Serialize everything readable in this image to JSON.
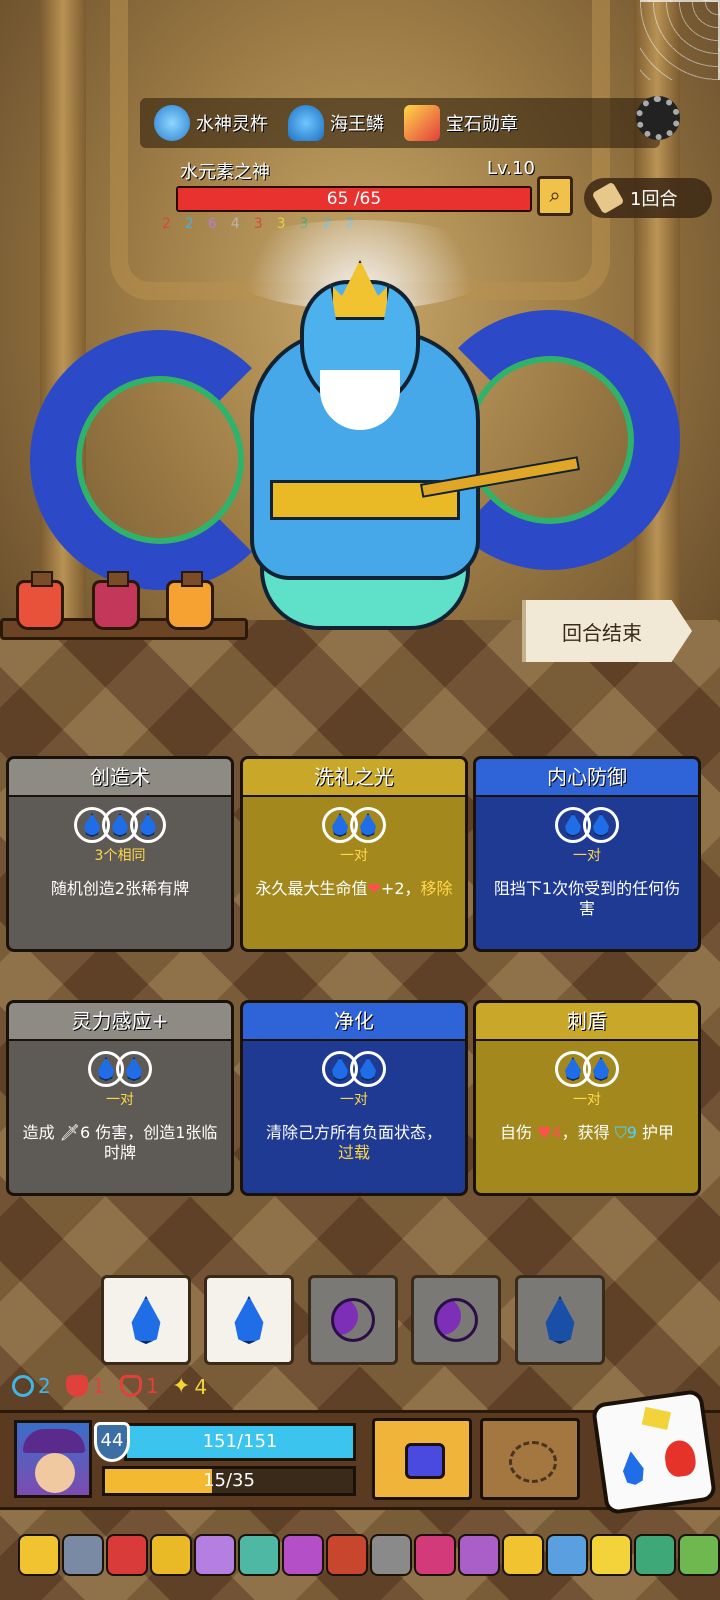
{
  "relics_top": [
    {
      "icon": "trident-icon",
      "label": "水神灵杵"
    },
    {
      "icon": "scale-icon",
      "label": "海王鳞"
    },
    {
      "icon": "medal-icon",
      "label": "宝石勋章"
    }
  ],
  "enemy": {
    "name": "水元素之神",
    "level": "Lv.10",
    "hp_text": "65 /65",
    "hp_fraction": 1.0,
    "statuses": [
      "2",
      "2",
      "6",
      "4",
      "3",
      "3",
      "3",
      "2",
      "2"
    ]
  },
  "round": {
    "label": "1回合"
  },
  "end_turn": {
    "label": "回合结束"
  },
  "cards": [
    {
      "title": "创造术",
      "style": "grey",
      "slots": 3,
      "requirement": "3个相同",
      "desc": "随机创造2张稀有牌"
    },
    {
      "title": "洗礼之光",
      "style": "gold",
      "slots": 2,
      "requirement": "一对",
      "desc_pre": "永久最大生命值",
      "desc_heart": "❤",
      "desc_mid": "+2，",
      "desc_hl": "移除"
    },
    {
      "title": "内心防御",
      "style": "blue",
      "slots": 2,
      "requirement": "一对",
      "desc": "阻挡下1次你受到的任何伤害"
    },
    {
      "title": "灵力感应+",
      "style": "grey",
      "slots": 2,
      "requirement": "一对",
      "desc_pre": "造成 ",
      "desc_sword": "🗡",
      "desc_mid": "6 伤害，创造1张临时牌"
    },
    {
      "title": "净化",
      "style": "blue",
      "slots": 2,
      "requirement": "一对",
      "desc_pre": "清除己方所有负面状态，",
      "desc_hl": "过载"
    },
    {
      "title": "刺盾",
      "style": "gold",
      "slots": 2,
      "requirement": "一对",
      "desc_pre": "自伤 ",
      "desc_dmg": "4",
      "desc_mid": "，获得 ",
      "desc_armor": "9",
      "desc_post": " 护甲"
    }
  ],
  "dice": [
    {
      "face": "drop",
      "style": "white"
    },
    {
      "face": "drop",
      "style": "white"
    },
    {
      "face": "moon",
      "style": "grey"
    },
    {
      "face": "moon",
      "style": "grey"
    },
    {
      "face": "drop",
      "style": "grey"
    }
  ],
  "player_status": [
    {
      "icon": "spiral-icon",
      "value": "2",
      "color": "#3fb6e8"
    },
    {
      "icon": "shield-crack-icon",
      "value": "1",
      "color": "#e0413a"
    },
    {
      "icon": "shield-broken-icon",
      "value": "1",
      "color": "#e0413a"
    },
    {
      "icon": "spark-icon",
      "value": "4",
      "color": "#f2d33a"
    }
  ],
  "player": {
    "armor": "44",
    "hp_text": "151/151",
    "xp_text": "15/35",
    "xp_fraction": 0.43
  },
  "relic_strip_colors": [
    "#f2c330",
    "#7a8aa4",
    "#d93b3b",
    "#e9b926",
    "#b47fe0",
    "#4fb8a4",
    "#b44fc8",
    "#c8452e",
    "#8a8a8a",
    "#d23a7a",
    "#a95ec8",
    "#f2c330",
    "#5aa0e0",
    "#f2d33a",
    "#3fa878",
    "#6fb84f"
  ],
  "colors": {
    "hp_red": "#e8322f",
    "hp_cyan": "#3bc5ee",
    "xp_gold": "#f2b931"
  }
}
